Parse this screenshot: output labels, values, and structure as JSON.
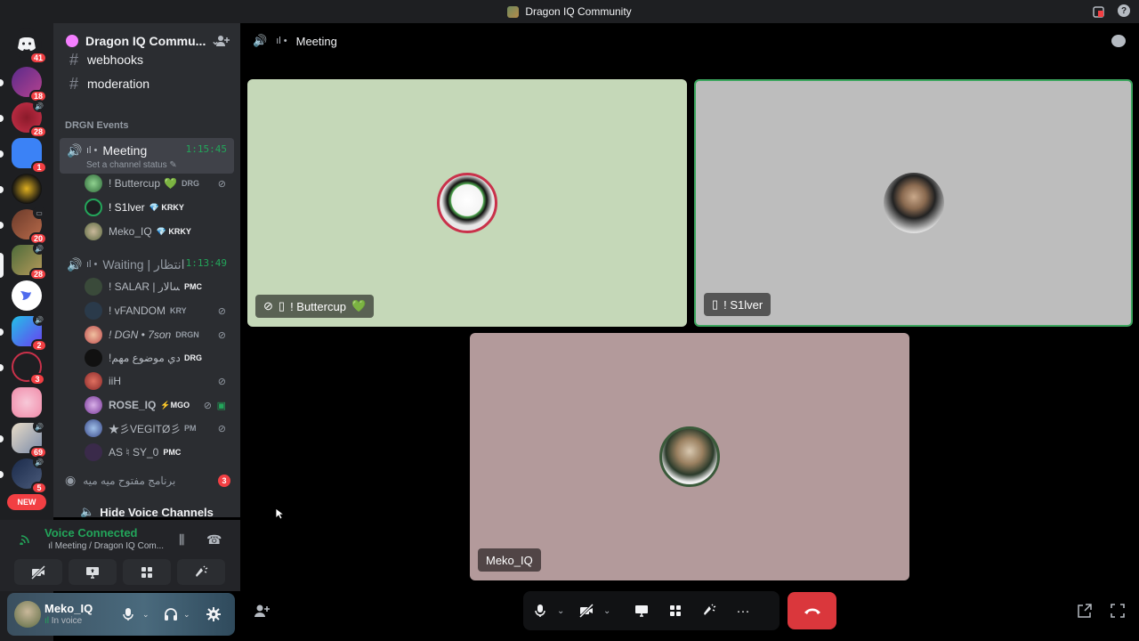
{
  "window": {
    "title": "Dragon IQ Community"
  },
  "rail": {
    "servers": [
      {
        "badge": "41"
      },
      {
        "badge": "18"
      },
      {
        "badge": "28"
      },
      {
        "badge": "1"
      },
      {
        "badge": ""
      },
      {
        "badge": "20"
      },
      {
        "badge": "28"
      },
      {
        "badge": ""
      },
      {
        "badge": "2"
      },
      {
        "badge": "3"
      },
      {
        "badge": ""
      },
      {
        "badge": "69"
      },
      {
        "badge": "5"
      }
    ],
    "new_label": "NEW"
  },
  "guild": {
    "name": "Dragon IQ Commu...",
    "channels": [
      {
        "name": "webhooks"
      },
      {
        "name": "moderation"
      }
    ],
    "category": "DRGN Events",
    "voice_channels": [
      {
        "name": "Meeting",
        "timer": "1:15:45",
        "status": "Set a channel status",
        "members": [
          {
            "name": "! Buttercup",
            "tag": "DRG",
            "muted": true
          },
          {
            "name": "! S1lver",
            "tag": "KRKY",
            "muted": false
          },
          {
            "name": "Meko_IQ",
            "tag": "KRKY",
            "muted": false
          }
        ]
      },
      {
        "name": "Waiting | انتظار",
        "timer": "1:13:49",
        "members": [
          {
            "name": "! SALAR | سالار",
            "tag": "PMC",
            "muted": false
          },
          {
            "name": "! vFANDOM",
            "tag": "KRY",
            "muted": true
          },
          {
            "name": "! DGN • 7son",
            "tag": "DRGN",
            "muted": true
          },
          {
            "name": "!عندي موضوع مهم",
            "tag": "DRG",
            "muted": false
          },
          {
            "name": "iiH",
            "tag": "",
            "muted": true
          },
          {
            "name": "ROSE_IQ",
            "tag": "MGO",
            "muted": true
          },
          {
            "name": "★彡VEGITØ彡★",
            "tag": "PM",
            "muted": true
          },
          {
            "name": "AS ♮ SY_0",
            "tag": "PMC",
            "muted": false
          }
        ]
      }
    ],
    "stage_channel": {
      "name": "برنامج مفتوح ميه ميه",
      "count": "3"
    },
    "hide_voice_label": "Hide Voice Channels"
  },
  "voice_panel": {
    "status": "Voice Connected",
    "location": "Meeting / Dragon IQ Com..."
  },
  "user_panel": {
    "name": "Meko_IQ",
    "status": "In voice"
  },
  "stage": {
    "channel": "Meeting",
    "tiles": [
      {
        "name": "! Buttercup",
        "bg": "#c5d8b8"
      },
      {
        "name": "! S1lver",
        "bg": "#bdbdbd"
      },
      {
        "name": "Meko_IQ",
        "bg": "#b39a9b"
      }
    ]
  },
  "colors": {
    "connected": "#23a55a",
    "danger": "#da373c",
    "speaking_outline": "#3ba55d"
  }
}
